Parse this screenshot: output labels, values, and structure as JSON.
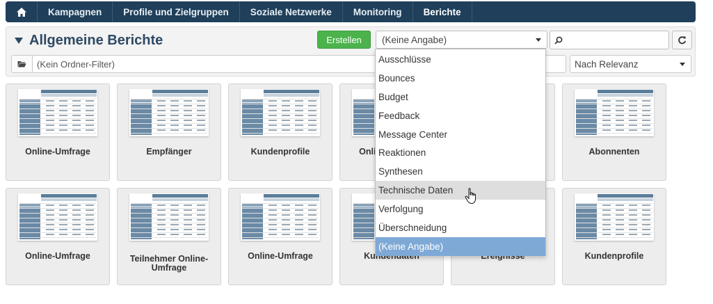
{
  "nav": {
    "home_icon": "home-icon",
    "items": [
      "Kampagnen",
      "Profile und Zielgruppen",
      "Soziale Netzwerke",
      "Monitoring",
      "Berichte"
    ],
    "active": "Berichte"
  },
  "header": {
    "title": "Allgemeine Berichte",
    "create_label": "Erstellen",
    "category_value": "(Keine Angabe)",
    "search_value": "",
    "folder_filter_placeholder": "(Kein Ordner-Filter)",
    "sort_value": "Nach Relevanz"
  },
  "dropdown": {
    "options": [
      "Ausschlüsse",
      "Bounces",
      "Budget",
      "Feedback",
      "Message Center",
      "Reaktionen",
      "Synthesen",
      "Technische Daten",
      "Verfolgung",
      "Überschneidung",
      "(Keine Angabe)"
    ],
    "hovered": "Technische Daten",
    "selected": "(Keine Angabe)"
  },
  "cards": [
    {
      "label": "Online-Umfrage"
    },
    {
      "label": "Empfänger"
    },
    {
      "label": "Kundenprofile"
    },
    {
      "label": "Online-Umfrage"
    },
    {
      "label": ""
    },
    {
      "label": "Abonnenten"
    },
    {
      "label": "Online-Umfrage"
    },
    {
      "label": "Teilnehmer Online-Umfrage"
    },
    {
      "label": "Online-Umfrage"
    },
    {
      "label": "Kundendaten"
    },
    {
      "label": "Ereignisse"
    },
    {
      "label": "Kundenprofile"
    }
  ],
  "colors": {
    "nav_bg": "#1f3f5b",
    "title": "#2e4a63",
    "create_button": "#4cb34c",
    "selected_option": "#7ea9d6"
  }
}
